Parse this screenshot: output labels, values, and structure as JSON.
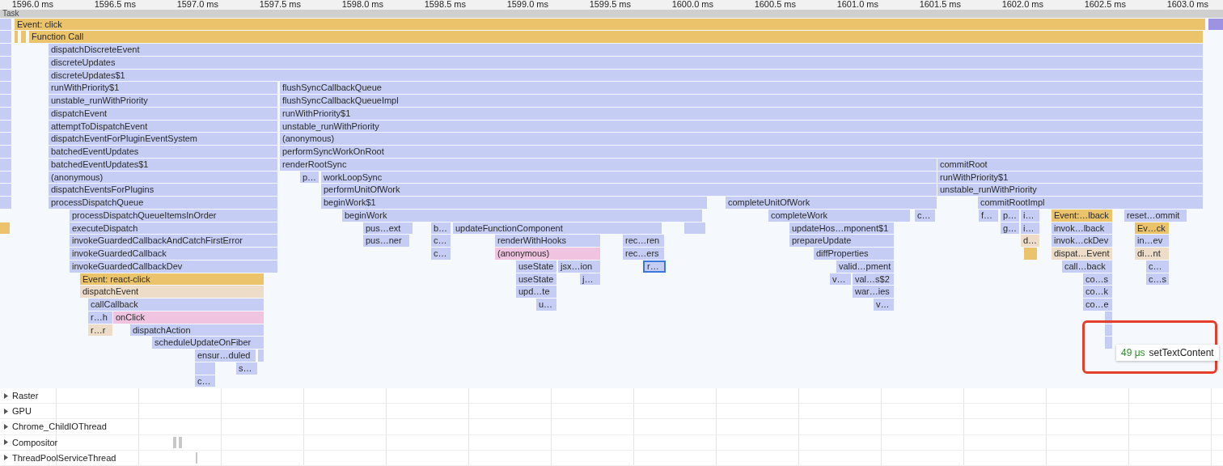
{
  "ruler": {
    "ticks": [
      "1596.0 ms",
      "1596.5 ms",
      "1597.0 ms",
      "1597.5 ms",
      "1598.0 ms",
      "1598.5 ms",
      "1599.0 ms",
      "1599.5 ms",
      "1600.0 ms",
      "1600.5 ms",
      "1601.0 ms",
      "1601.5 ms",
      "1602.0 ms",
      "1602.5 ms",
      "1603.0 ms"
    ]
  },
  "task": {
    "label": "Task"
  },
  "flame_rows": [
    [
      {
        "color": "#c5cdf4",
        "selected": false
      },
      {
        "label": "Event: click",
        "color": "#ebc36b",
        "selected": false
      },
      {
        "color": "#9e92e2",
        "selected": false
      }
    ],
    [
      {
        "color": "#c5cdf4",
        "selected": false
      },
      {
        "color": "#ebc36b",
        "selected": false
      },
      {
        "color": "#ebc36b",
        "selected": false
      },
      {
        "label": "Function Call",
        "color": "#ebc36b",
        "selected": false
      }
    ],
    [
      {
        "color": "#c5cdf4",
        "selected": false
      },
      {
        "label": "dispatchDiscreteEvent",
        "color": "#c5cdf4",
        "selected": false
      }
    ],
    [
      {
        "color": "#c5cdf4",
        "selected": false
      },
      {
        "label": "discreteUpdates",
        "color": "#c5cdf4",
        "selected": false
      }
    ],
    [
      {
        "color": "#c5cdf4",
        "selected": false
      },
      {
        "label": "discreteUpdates$1",
        "color": "#c5cdf4",
        "selected": false
      }
    ],
    [
      {
        "color": "#c5cdf4",
        "selected": false
      },
      {
        "label": "runWithPriority$1",
        "color": "#c5cdf4",
        "selected": false
      },
      {
        "label": "flushSyncCallbackQueue",
        "color": "#c5cdf4",
        "selected": false
      }
    ],
    [
      {
        "color": "#c5cdf4",
        "selected": false
      },
      {
        "label": "unstable_runWithPriority",
        "color": "#c5cdf4",
        "selected": false
      },
      {
        "label": "flushSyncCallbackQueueImpl",
        "color": "#c5cdf4",
        "selected": false
      }
    ],
    [
      {
        "color": "#c5cdf4",
        "selected": false
      },
      {
        "label": "dispatchEvent",
        "color": "#c5cdf4",
        "selected": false
      },
      {
        "label": "runWithPriority$1",
        "color": "#c5cdf4",
        "selected": false
      }
    ],
    [
      {
        "color": "#c5cdf4",
        "selected": false
      },
      {
        "label": "attemptToDispatchEvent",
        "color": "#c5cdf4",
        "selected": false
      },
      {
        "label": "unstable_runWithPriority",
        "color": "#c5cdf4",
        "selected": false
      }
    ],
    [
      {
        "color": "#c5cdf4",
        "selected": false
      },
      {
        "label": "dispatchEventForPluginEventSystem",
        "color": "#c5cdf4",
        "selected": false
      },
      {
        "label": "(anonymous)",
        "color": "#c5cdf4",
        "selected": false
      }
    ],
    [
      {
        "color": "#c5cdf4",
        "selected": false
      },
      {
        "label": "batchedEventUpdates",
        "color": "#c5cdf4",
        "selected": false
      },
      {
        "label": "performSyncWorkOnRoot",
        "color": "#c5cdf4",
        "selected": false
      }
    ],
    [
      {
        "color": "#c5cdf4",
        "selected": false
      },
      {
        "label": "batchedEventUpdates$1",
        "color": "#c5cdf4",
        "selected": false
      },
      {
        "label": "renderRootSync",
        "color": "#c5cdf4",
        "selected": false
      },
      {
        "label": "commitRoot",
        "color": "#c5cdf4",
        "selected": false
      }
    ],
    [
      {
        "color": "#c5cdf4",
        "selected": false
      },
      {
        "label": "(anonymous)",
        "color": "#c5cdf4",
        "selected": false
      },
      {
        "label": "p…",
        "color": "#c5cdf4",
        "selected": false
      },
      {
        "label": "workLoopSync",
        "color": "#c5cdf4",
        "selected": false
      },
      {
        "label": "runWithPriority$1",
        "color": "#c5cdf4",
        "selected": false
      }
    ],
    [
      {
        "color": "#c5cdf4",
        "selected": false
      },
      {
        "label": "dispatchEventsForPlugins",
        "color": "#c5cdf4",
        "selected": false
      },
      {
        "label": "performUnitOfWork",
        "color": "#c5cdf4",
        "selected": false
      },
      {
        "label": "unstable_runWithPriority",
        "color": "#c5cdf4",
        "selected": false
      }
    ],
    [
      {
        "color": "#c5cdf4",
        "selected": false
      },
      {
        "label": "processDispatchQueue",
        "color": "#c5cdf4",
        "selected": false
      },
      {
        "label": "beginWork$1",
        "color": "#c5cdf4",
        "selected": false
      },
      {
        "label": "completeUnitOfWork",
        "color": "#c5cdf4",
        "selected": false
      },
      {
        "label": "commitRootImpl",
        "color": "#c5cdf4",
        "selected": false
      }
    ],
    [
      {
        "label": "processDispatchQueueItemsInOrder",
        "color": "#c5cdf4",
        "selected": false
      },
      {
        "label": "beginWork",
        "color": "#c5cdf4",
        "selected": false
      },
      {
        "label": "completeWork",
        "color": "#c5cdf4",
        "selected": false
      },
      {
        "label": "c…",
        "color": "#c5cdf4",
        "selected": false
      },
      {
        "label": "f…",
        "color": "#c5cdf4",
        "selected": false
      },
      {
        "label": "p…",
        "color": "#c5cdf4",
        "selected": false
      },
      {
        "label": "i…",
        "color": "#c5cdf4",
        "selected": false
      },
      {
        "label": "Event:…lback",
        "color": "#ebc36b",
        "selected": false
      },
      {
        "label": "reset…ommit",
        "color": "#c5cdf4",
        "selected": false
      }
    ],
    [
      {
        "color": "#ebc36b",
        "selected": false
      },
      {
        "label": "executeDispatch",
        "color": "#c5cdf4",
        "selected": false
      },
      {
        "label": "pus…ext",
        "color": "#c5cdf4",
        "selected": false
      },
      {
        "label": "b…",
        "color": "#c5cdf4",
        "selected": false
      },
      {
        "label": "updateFunctionComponent",
        "color": "#c5cdf4",
        "selected": false
      },
      {
        "color": "#c5cdf4",
        "selected": false
      },
      {
        "label": "updateHos…mponent$1",
        "color": "#c5cdf4",
        "selected": false
      },
      {
        "label": "g…",
        "color": "#c5cdf4",
        "selected": false
      },
      {
        "label": "i…",
        "color": "#c5cdf4",
        "selected": false
      },
      {
        "label": "invok…lback",
        "color": "#c5cdf4",
        "selected": false
      },
      {
        "label": "Ev…ck",
        "color": "#ebc36b",
        "selected": false
      }
    ],
    [
      {
        "label": "invokeGuardedCallbackAndCatchFirstError",
        "color": "#c5cdf4",
        "selected": false
      },
      {
        "label": "pus…ner",
        "color": "#c5cdf4",
        "selected": false
      },
      {
        "label": "c…",
        "color": "#c5cdf4",
        "selected": false
      },
      {
        "label": "renderWithHooks",
        "color": "#c5cdf4",
        "selected": false
      },
      {
        "label": "rec…ren",
        "color": "#c5cdf4",
        "selected": false
      },
      {
        "label": "prepareUpdate",
        "color": "#c5cdf4",
        "selected": false
      },
      {
        "label": "d…",
        "color": "#ecdcc8",
        "selected": false
      },
      {
        "label": "invok…ckDev",
        "color": "#c5cdf4",
        "selected": false
      },
      {
        "label": "in…ev",
        "color": "#c5cdf4",
        "selected": false
      }
    ],
    [
      {
        "label": "invokeGuardedCallback",
        "color": "#c5cdf4",
        "selected": false
      },
      {
        "label": "c…",
        "color": "#c5cdf4",
        "selected": false
      },
      {
        "label": "(anonymous)",
        "color": "#f0c4e0",
        "selected": false
      },
      {
        "label": "rec…ers",
        "color": "#c5cdf4",
        "selected": false
      },
      {
        "label": "diffProperties",
        "color": "#c5cdf4",
        "selected": false
      },
      {
        "color": "#ebc36b",
        "selected": false
      },
      {
        "label": "dispat…Event",
        "color": "#ecdcc8",
        "selected": false
      },
      {
        "label": "di…nt",
        "color": "#ecdcc8",
        "selected": false
      }
    ],
    [
      {
        "label": "invokeGuardedCallbackDev",
        "color": "#c5cdf4",
        "selected": false
      },
      {
        "label": "useState",
        "color": "#c5cdf4",
        "selected": false
      },
      {
        "label": "jsx…ion",
        "color": "#c5cdf4",
        "selected": false
      },
      {
        "label": "r…",
        "color": "#c5cdf4",
        "selected": true
      },
      {
        "label": "valid…pment",
        "color": "#c5cdf4",
        "selected": false
      },
      {
        "label": "call…back",
        "color": "#c5cdf4",
        "selected": false
      },
      {
        "label": "c…",
        "color": "#c5cdf4",
        "selected": false
      }
    ],
    [
      {
        "label": "Event: react-click",
        "color": "#ebc36b",
        "selected": false
      },
      {
        "label": "useState",
        "color": "#c5cdf4",
        "selected": false
      },
      {
        "label": "j…",
        "color": "#c5cdf4",
        "selected": false
      },
      {
        "label": "v…",
        "color": "#c5cdf4",
        "selected": false
      },
      {
        "label": "val…s$2",
        "color": "#c5cdf4",
        "selected": false
      },
      {
        "label": "co…s",
        "color": "#c5cdf4",
        "selected": false
      },
      {
        "label": "c…s",
        "color": "#c5cdf4",
        "selected": false
      }
    ],
    [
      {
        "label": "dispatchEvent",
        "color": "#ecdcc8",
        "selected": false
      },
      {
        "label": "upd…te",
        "color": "#c5cdf4",
        "selected": false
      },
      {
        "label": "war…ies",
        "color": "#c5cdf4",
        "selected": false
      },
      {
        "label": "co…k",
        "color": "#c5cdf4",
        "selected": false
      }
    ],
    [
      {
        "label": "callCallback",
        "color": "#c5cdf4",
        "selected": false
      },
      {
        "label": "u…",
        "color": "#c5cdf4",
        "selected": false
      },
      {
        "label": "v…",
        "color": "#c5cdf4",
        "selected": false
      },
      {
        "label": "co…e",
        "color": "#c5cdf4",
        "selected": false
      }
    ],
    [
      {
        "label": "r…h",
        "color": "#c5cdf4",
        "selected": false
      },
      {
        "label": "onClick",
        "color": "#f0c4e0",
        "selected": false
      },
      {
        "color": "#c5cdf4",
        "selected": false
      }
    ],
    [
      {
        "label": "r…r",
        "color": "#ecdcc8",
        "selected": false
      },
      {
        "label": "dispatchAction",
        "color": "#c5cdf4",
        "selected": false
      },
      {
        "color": "#c5cdf4",
        "selected": false
      }
    ],
    [
      {
        "label": "scheduleUpdateOnFiber",
        "color": "#c5cdf4",
        "selected": false
      },
      {
        "color": "#c5cdf4",
        "selected": false
      }
    ],
    [
      {
        "label": "ensur…duled",
        "color": "#c5cdf4",
        "selected": false
      },
      {
        "color": "#c5cdf4",
        "selected": false
      }
    ],
    [
      {
        "color": "#c5cdf4",
        "selected": false
      },
      {
        "label": "s…",
        "color": "#c5cdf4",
        "selected": false
      }
    ],
    [
      {
        "label": "c…",
        "color": "#c5cdf4",
        "selected": false
      }
    ]
  ],
  "tooltip": {
    "duration": "49 μs",
    "name": "setTextContent"
  },
  "threads": [
    {
      "label": "Raster",
      "expanded": false
    },
    {
      "label": "GPU",
      "expanded": false
    },
    {
      "label": "Chrome_ChildIOThread",
      "expanded": false
    },
    {
      "label": "Compositor",
      "expanded": false
    },
    {
      "label": "ThreadPoolServiceThread",
      "expanded": false
    }
  ]
}
